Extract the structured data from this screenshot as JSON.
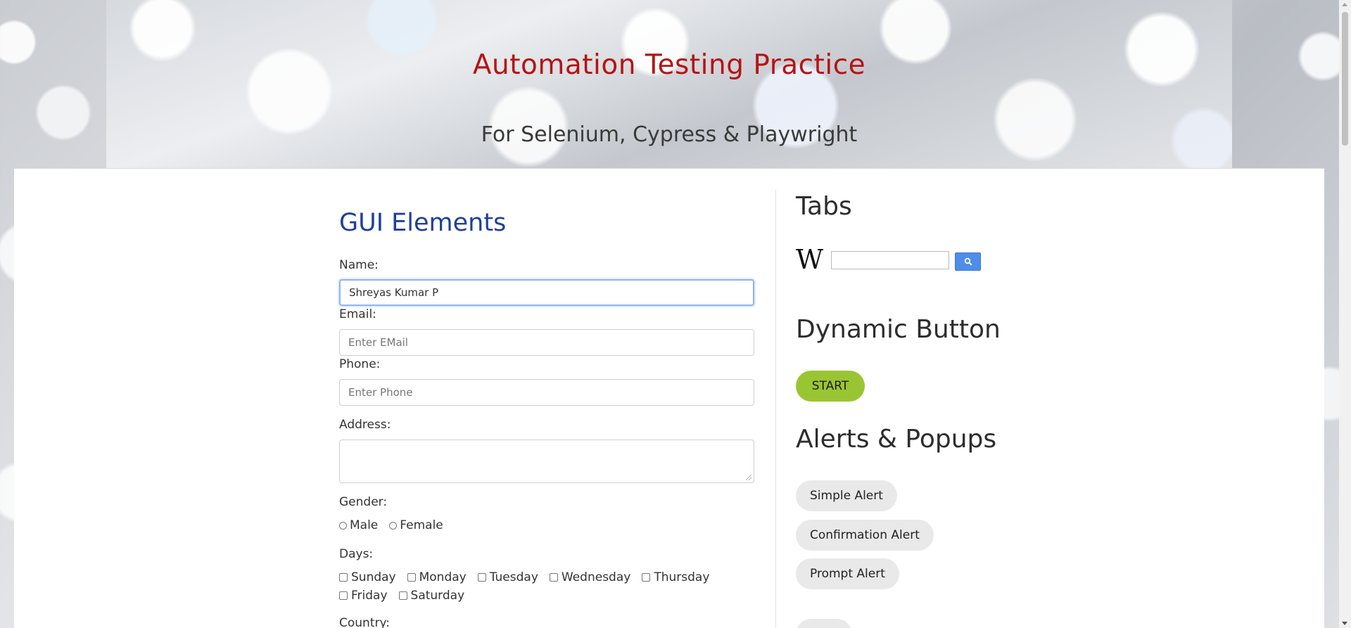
{
  "header": {
    "title": "Automation Testing Practice",
    "subtitle": "For Selenium, Cypress & Playwright",
    "title_color": "#b51414"
  },
  "gui": {
    "heading": "GUI Elements",
    "heading_color": "#1f3f9a",
    "name_label": "Name:",
    "name_value": "Shreyas Kumar P",
    "email_label": "Email:",
    "email_placeholder": "Enter EMail",
    "phone_label": "Phone:",
    "phone_placeholder": "Enter Phone",
    "address_label": "Address:",
    "gender_label": "Gender:",
    "gender_options": [
      "Male",
      "Female"
    ],
    "days_label": "Days:",
    "days_row1": [
      "Sunday",
      "Monday",
      "Tuesday",
      "Wednesday",
      "Thursday"
    ],
    "days_row2": [
      "Friday",
      "Saturday"
    ],
    "country_label": "Country:"
  },
  "tabs": {
    "heading": "Tabs",
    "wiki_logo": "W",
    "search_icon": "magnifier-icon",
    "search_button_color": "#4f8de9"
  },
  "dynamic": {
    "heading": "Dynamic Button",
    "start_label": "START",
    "start_color": "#9ac532"
  },
  "alerts": {
    "heading": "Alerts & Popups",
    "buttons": [
      "Simple Alert",
      "Confirmation Alert",
      "Prompt Alert"
    ]
  }
}
